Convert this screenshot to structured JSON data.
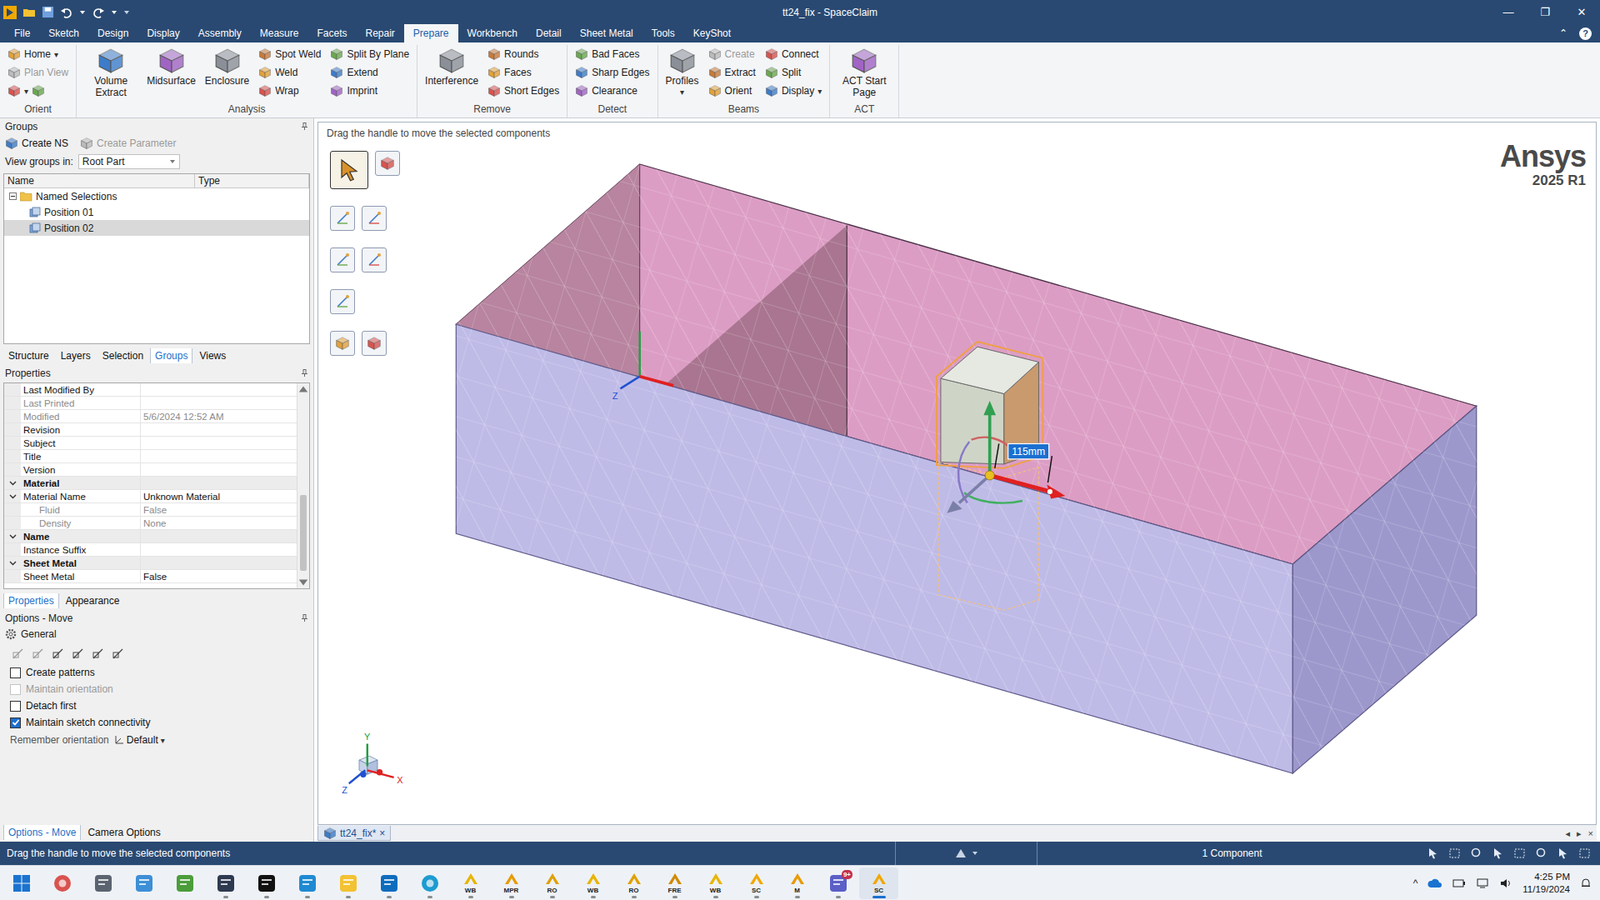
{
  "window": {
    "title": "tt24_fix - SpaceClaim",
    "controls": [
      "—",
      "❐",
      "✕"
    ]
  },
  "menu": {
    "tabs": [
      {
        "label": "File",
        "selected": false
      },
      {
        "label": "Sketch",
        "selected": false
      },
      {
        "label": "Design",
        "selected": false
      },
      {
        "label": "Display",
        "selected": false
      },
      {
        "label": "Assembly",
        "selected": false
      },
      {
        "label": "Measure",
        "selected": false
      },
      {
        "label": "Facets",
        "selected": false
      },
      {
        "label": "Repair",
        "selected": false
      },
      {
        "label": "Prepare",
        "selected": true
      },
      {
        "label": "Workbench",
        "selected": false
      },
      {
        "label": "Detail",
        "selected": false
      },
      {
        "label": "Sheet Metal",
        "selected": false
      },
      {
        "label": "Tools",
        "selected": false
      },
      {
        "label": "KeyShot",
        "selected": false
      }
    ],
    "collapse": "⌃",
    "help": "?"
  },
  "ribbon": {
    "groups": [
      {
        "name": "Orient",
        "columns": [
          {
            "kind": "stack",
            "items": [
              {
                "label": "Home",
                "caret": "▾",
                "disabled": false
              },
              {
                "label": "Plan View",
                "caret": "",
                "disabled": true
              },
              {
                "label": "",
                "caret": "▾",
                "disabled": false
              }
            ]
          }
        ]
      },
      {
        "name": "Analysis",
        "columns": [
          {
            "kind": "large",
            "items": [
              {
                "label": "Volume Extract",
                "caret": "",
                "disabled": false
              }
            ]
          },
          {
            "kind": "large",
            "items": [
              {
                "label": "Midsurface",
                "caret": "",
                "disabled": false
              }
            ]
          },
          {
            "kind": "large",
            "items": [
              {
                "label": "Enclosure",
                "caret": "",
                "disabled": false
              }
            ]
          },
          {
            "kind": "stack",
            "items": [
              {
                "label": "Spot Weld",
                "caret": "",
                "disabled": false
              },
              {
                "label": "Weld",
                "caret": "",
                "disabled": false
              },
              {
                "label": "Wrap",
                "caret": "",
                "disabled": false
              }
            ]
          },
          {
            "kind": "stack",
            "items": [
              {
                "label": "Split By Plane",
                "caret": "",
                "disabled": false
              },
              {
                "label": "Extend",
                "caret": "",
                "disabled": false
              },
              {
                "label": "Imprint",
                "caret": "",
                "disabled": false
              }
            ]
          }
        ]
      },
      {
        "name": "Remove",
        "columns": [
          {
            "kind": "large",
            "items": [
              {
                "label": "Interference",
                "caret": "",
                "disabled": false
              }
            ]
          },
          {
            "kind": "stack",
            "items": [
              {
                "label": "Rounds",
                "caret": "",
                "disabled": false
              },
              {
                "label": "Faces",
                "caret": "",
                "disabled": false
              },
              {
                "label": "Short Edges",
                "caret": "",
                "disabled": false
              }
            ]
          }
        ]
      },
      {
        "name": "Detect",
        "columns": [
          {
            "kind": "stack",
            "items": [
              {
                "label": "Bad Faces",
                "caret": "",
                "disabled": false
              },
              {
                "label": "Sharp Edges",
                "caret": "",
                "disabled": false
              },
              {
                "label": "Clearance",
                "caret": "",
                "disabled": false
              }
            ]
          }
        ]
      },
      {
        "name": "Beams",
        "columns": [
          {
            "kind": "large",
            "items": [
              {
                "label": "Profiles",
                "caret": "▾",
                "disabled": false
              }
            ]
          },
          {
            "kind": "stack",
            "items": [
              {
                "label": "Create",
                "caret": "",
                "disabled": true
              },
              {
                "label": "Extract",
                "caret": "",
                "disabled": false
              },
              {
                "label": "Orient",
                "caret": "",
                "disabled": false
              }
            ]
          },
          {
            "kind": "stack",
            "items": [
              {
                "label": "Connect",
                "caret": "",
                "disabled": false
              },
              {
                "label": "Split",
                "caret": "",
                "disabled": false
              },
              {
                "label": "Display",
                "caret": "▾",
                "disabled": false
              }
            ]
          }
        ]
      },
      {
        "name": "ACT",
        "columns": [
          {
            "kind": "large",
            "items": [
              {
                "label": "ACT Start Page",
                "caret": "",
                "disabled": false
              }
            ]
          }
        ]
      }
    ]
  },
  "groups_panel": {
    "title": "Groups",
    "create_ns": "Create NS",
    "create_parameter": {
      "label": "Create Parameter",
      "disabled": true
    },
    "view_groups_in": {
      "label": "View groups in:",
      "value": "Root Part"
    },
    "columns": [
      "Name",
      "Type"
    ],
    "tree": [
      {
        "label": "Named Selections",
        "kind": "folder",
        "level": 0,
        "expanded": true,
        "selected": false
      },
      {
        "label": "Position 01",
        "kind": "selection",
        "level": 1,
        "expanded": false,
        "selected": false
      },
      {
        "label": "Position 02",
        "kind": "selection",
        "level": 1,
        "expanded": false,
        "selected": true
      }
    ],
    "tabs": [
      {
        "label": "Structure",
        "selected": false
      },
      {
        "label": "Layers",
        "selected": false
      },
      {
        "label": "Selection",
        "selected": false
      },
      {
        "label": "Groups",
        "selected": true
      },
      {
        "label": "Views",
        "selected": false
      }
    ]
  },
  "properties": {
    "title": "Properties",
    "scroll": {
      "thumb_start": 0.55,
      "thumb_size": 0.42
    },
    "rows": [
      {
        "kind": "row",
        "name": "Last Modified By",
        "value": "",
        "disabled": false,
        "indent": false,
        "expandable": false,
        "expanded": false
      },
      {
        "kind": "row",
        "name": "Last Printed",
        "value": "",
        "disabled": true,
        "indent": false,
        "expandable": false,
        "expanded": false
      },
      {
        "kind": "row",
        "name": "Modified",
        "value": "5/6/2024 12:52 AM",
        "disabled": true,
        "indent": false,
        "expandable": false,
        "expanded": false
      },
      {
        "kind": "row",
        "name": "Revision",
        "value": "",
        "disabled": false,
        "indent": false,
        "expandable": false,
        "expanded": false
      },
      {
        "kind": "row",
        "name": "Subject",
        "value": "",
        "disabled": false,
        "indent": false,
        "expandable": false,
        "expanded": false
      },
      {
        "kind": "row",
        "name": "Title",
        "value": "",
        "disabled": false,
        "indent": false,
        "expandable": false,
        "expanded": false
      },
      {
        "kind": "row",
        "name": "Version",
        "value": "",
        "disabled": false,
        "indent": false,
        "expandable": false,
        "expanded": false
      },
      {
        "kind": "section",
        "name": "Material",
        "value": "",
        "disabled": false,
        "indent": false,
        "expandable": true,
        "expanded": true
      },
      {
        "kind": "row",
        "name": "Material Name",
        "value": "Unknown Material",
        "disabled": false,
        "indent": false,
        "expandable": true,
        "expanded": true
      },
      {
        "kind": "row",
        "name": "Fluid",
        "value": "False",
        "disabled": true,
        "indent": true,
        "expandable": false,
        "expanded": false
      },
      {
        "kind": "row",
        "name": "Density",
        "value": "None",
        "disabled": true,
        "indent": true,
        "expandable": false,
        "expanded": false
      },
      {
        "kind": "section",
        "name": "Name",
        "value": "",
        "disabled": false,
        "indent": false,
        "expandable": true,
        "expanded": true
      },
      {
        "kind": "row",
        "name": "Instance Suffix",
        "value": "",
        "disabled": false,
        "indent": false,
        "expandable": false,
        "expanded": false
      },
      {
        "kind": "section",
        "name": "Sheet Metal",
        "value": "",
        "disabled": false,
        "indent": false,
        "expandable": true,
        "expanded": true
      },
      {
        "kind": "row",
        "name": "Sheet Metal",
        "value": "False",
        "disabled": false,
        "indent": false,
        "expandable": false,
        "expanded": false
      }
    ],
    "tabs": [
      {
        "label": "Properties",
        "selected": true
      },
      {
        "label": "Appearance",
        "selected": false
      }
    ]
  },
  "options": {
    "title": "Options - Move",
    "section": "General",
    "checkboxes": [
      {
        "label": "Create patterns",
        "checked": false,
        "disabled": false
      },
      {
        "label": "Maintain orientation",
        "checked": false,
        "disabled": true
      },
      {
        "label": "Detach first",
        "checked": false,
        "disabled": false
      },
      {
        "label": "Maintain sketch connectivity",
        "checked": true,
        "disabled": false
      }
    ],
    "remember_orientation": {
      "label": "Remember orientation",
      "value": "Default",
      "caret": "▾"
    },
    "tabs": [
      {
        "label": "Options - Move",
        "selected": true
      },
      {
        "label": "Camera Options",
        "selected": false
      }
    ]
  },
  "viewport": {
    "hint": "Drag the handle to move the selected components",
    "logo": {
      "name": "Ansys",
      "version": "2025 R1"
    },
    "dimension": "115mm",
    "local_axis_label": "Z",
    "triad": {
      "x": "X",
      "y": "Y",
      "z": "Z"
    },
    "tools": [
      {
        "selected": true
      },
      {
        "selected": false
      },
      {
        "selected": false
      },
      {
        "selected": false
      },
      {
        "selected": false
      },
      {
        "selected": false
      },
      {
        "selected": false
      },
      {
        "selected": false
      },
      {
        "selected": false
      }
    ]
  },
  "document_tabs": {
    "tabs": [
      {
        "label": "tt24_fix*",
        "close": "×",
        "selected": true
      }
    ],
    "controls": [
      "◂",
      "▸",
      "×"
    ]
  },
  "status_bar": {
    "message": "Drag the handle to move the selected components",
    "selection": "1 Component"
  },
  "taskbar": {
    "items": [
      {
        "kind": "windows",
        "label": "",
        "color": "#1a73d0",
        "running": false,
        "active": false,
        "badge": ""
      },
      {
        "kind": "circle",
        "label": "",
        "color": "#d9534f",
        "running": false,
        "active": false,
        "badge": ""
      },
      {
        "kind": "tile",
        "label": "",
        "color": "#5c6370",
        "running": false,
        "active": false,
        "badge": ""
      },
      {
        "kind": "tile",
        "label": "",
        "color": "#3d8fd6",
        "running": false,
        "active": false,
        "badge": ""
      },
      {
        "kind": "tile",
        "label": "",
        "color": "#4b9d3a",
        "running": false,
        "active": false,
        "badge": ""
      },
      {
        "kind": "tile",
        "label": "",
        "color": "#2d3a4f",
        "running": true,
        "active": false,
        "badge": ""
      },
      {
        "kind": "tile",
        "label": "",
        "color": "#111111",
        "running": true,
        "active": false,
        "badge": ""
      },
      {
        "kind": "tile",
        "label": "",
        "color": "#1f8ad2",
        "running": true,
        "active": false,
        "badge": ""
      },
      {
        "kind": "tile",
        "label": "",
        "color": "#f2c233",
        "running": true,
        "active": false,
        "badge": ""
      },
      {
        "kind": "tile",
        "label": "",
        "color": "#0f6cbd",
        "running": true,
        "active": false,
        "badge": ""
      },
      {
        "kind": "circle",
        "label": "",
        "color": "#1d9bd1",
        "running": true,
        "active": false,
        "badge": ""
      },
      {
        "kind": "labeled",
        "label": "WB",
        "color": "#e8b400",
        "running": true,
        "active": false,
        "badge": ""
      },
      {
        "kind": "labeled",
        "label": "MPR",
        "color": "#e89a00",
        "running": true,
        "active": false,
        "badge": ""
      },
      {
        "kind": "labeled",
        "label": "RO",
        "color": "#e0a000",
        "running": true,
        "active": false,
        "badge": ""
      },
      {
        "kind": "labeled",
        "label": "WB",
        "color": "#e8b400",
        "running": true,
        "active": false,
        "badge": ""
      },
      {
        "kind": "labeled",
        "label": "RO",
        "color": "#e0a000",
        "running": true,
        "active": false,
        "badge": ""
      },
      {
        "kind": "labeled",
        "label": "FRE",
        "color": "#d08a00",
        "running": true,
        "active": false,
        "badge": ""
      },
      {
        "kind": "labeled",
        "label": "WB",
        "color": "#e8b400",
        "running": true,
        "active": false,
        "badge": ""
      },
      {
        "kind": "labeled",
        "label": "SC",
        "color": "#f0a800",
        "running": true,
        "active": false,
        "badge": ""
      },
      {
        "kind": "labeled",
        "label": "M",
        "color": "#e89a00",
        "running": true,
        "active": false,
        "badge": ""
      },
      {
        "kind": "tile",
        "label": "",
        "color": "#5b5fc7",
        "running": true,
        "active": false,
        "badge": "9+"
      },
      {
        "kind": "labeled",
        "label": "SC",
        "color": "#f0a800",
        "running": true,
        "active": true,
        "badge": ""
      }
    ],
    "tray_caret": "^",
    "time": "4:25 PM",
    "date": "11/19/2024"
  }
}
